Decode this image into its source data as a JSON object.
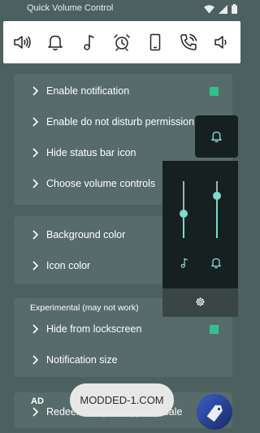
{
  "status_bar": {
    "title": "Quick Volume Control"
  },
  "icon_strip": [
    "volume-high-icon",
    "bell-icon",
    "music-note-icon",
    "alarm-clock-icon",
    "phone-device-icon",
    "phone-call-icon",
    "volume-low-icon"
  ],
  "settings_group_1": {
    "items": [
      {
        "label": "Enable notification",
        "checked": true
      },
      {
        "label": "Enable do not disturb permission"
      },
      {
        "label": "Hide status bar icon"
      },
      {
        "label": "Choose volume controls"
      }
    ]
  },
  "settings_group_2": {
    "items": [
      {
        "label": "Background color"
      },
      {
        "label": "Icon color"
      }
    ]
  },
  "settings_group_3": {
    "header": "Experimental (may not work)",
    "items": [
      {
        "label": "Hide from lockscreen",
        "checked": true
      },
      {
        "label": "Notification size"
      }
    ]
  },
  "ad_card": {
    "ad_label": "AD",
    "text": "Redeemer - paid apps on sale"
  },
  "volume_popup": {
    "sliders": [
      {
        "name": "music",
        "level": 0.43
      },
      {
        "name": "notification",
        "level": 0.75
      }
    ]
  },
  "toast": {
    "text": "MODDED-1.COM"
  },
  "colors": {
    "background": "#4d6060",
    "card": "#576b6b",
    "accent": "#2ec38e",
    "popup": "#172020",
    "slider": "#7fd9cc"
  }
}
